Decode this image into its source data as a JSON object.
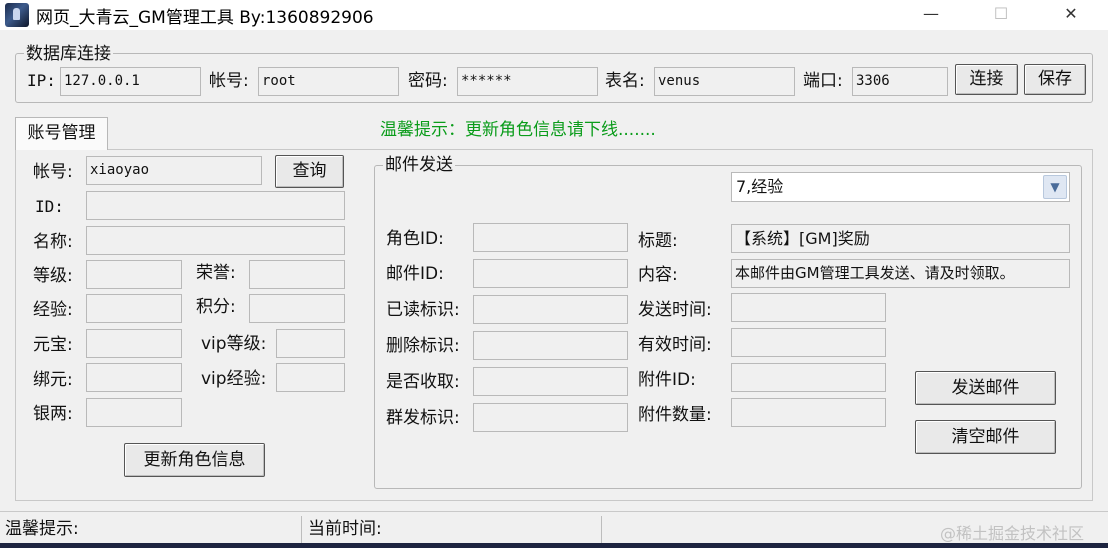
{
  "window": {
    "title": "网页_大青云_GM管理工具 By:1360892906",
    "minimize": "—",
    "maximize": "☐",
    "close": "✕"
  },
  "db": {
    "legend": "数据库连接",
    "ip_label": "IP:",
    "ip_value": "127.0.0.1",
    "account_label": "帐号:",
    "account_value": "root",
    "password_label": "密码:",
    "password_value": "******",
    "table_label": "表名:",
    "table_value": "venus",
    "port_label": "端口:",
    "port_value": "3306",
    "connect_label": "连接",
    "save_label": "保存"
  },
  "hint_top": "温馨提示：更新角色信息请下线.......",
  "tab": {
    "label": "账号管理"
  },
  "account": {
    "account_label": "帐号:",
    "account_value": "xiaoyao",
    "query_label": "查询",
    "id_label": "ID:",
    "id_value": "",
    "name_label": "名称:",
    "name_value": "",
    "level_label": "等级:",
    "level_value": "",
    "honor_label": "荣誉:",
    "honor_value": "",
    "exp_label": "经验:",
    "exp_value": "",
    "points_label": "积分:",
    "points_value": "",
    "yuanbao_label": "元宝:",
    "yuanbao_value": "",
    "vip_level_label": "vip等级:",
    "vip_level_value": "",
    "bind_label": "绑元:",
    "bind_value": "",
    "vip_exp_label": "vip经验:",
    "vip_exp_value": "",
    "silver_label": "银两:",
    "silver_value": "",
    "update_label": "更新角色信息"
  },
  "mail": {
    "legend": "邮件发送",
    "type_selected": "7,经验",
    "role_id_label": "角色ID:",
    "role_id_value": "",
    "mail_id_label": "邮件ID:",
    "mail_id_value": "",
    "read_label": "已读标识:",
    "read_value": "",
    "delete_label": "删除标识:",
    "delete_value": "",
    "received_label": "是否收取:",
    "received_value": "",
    "group_label": "群发标识:",
    "group_value": "",
    "title_label": "标题:",
    "title_value": "【系统】[GM]奖励",
    "content_label": "内容:",
    "content_value": "本邮件由GM管理工具发送、请及时领取。",
    "send_time_label": "发送时间:",
    "send_time_value": "",
    "valid_time_label": "有效时间:",
    "valid_time_value": "",
    "attach_id_label": "附件ID:",
    "attach_id_value": "",
    "attach_count_label": "附件数量:",
    "attach_count_value": "",
    "send_label": "发送邮件",
    "clear_label": "清空邮件"
  },
  "status": {
    "hint_label": "温馨提示:",
    "time_label": "当前时间:"
  },
  "watermark": "@稀土掘金技术社区"
}
